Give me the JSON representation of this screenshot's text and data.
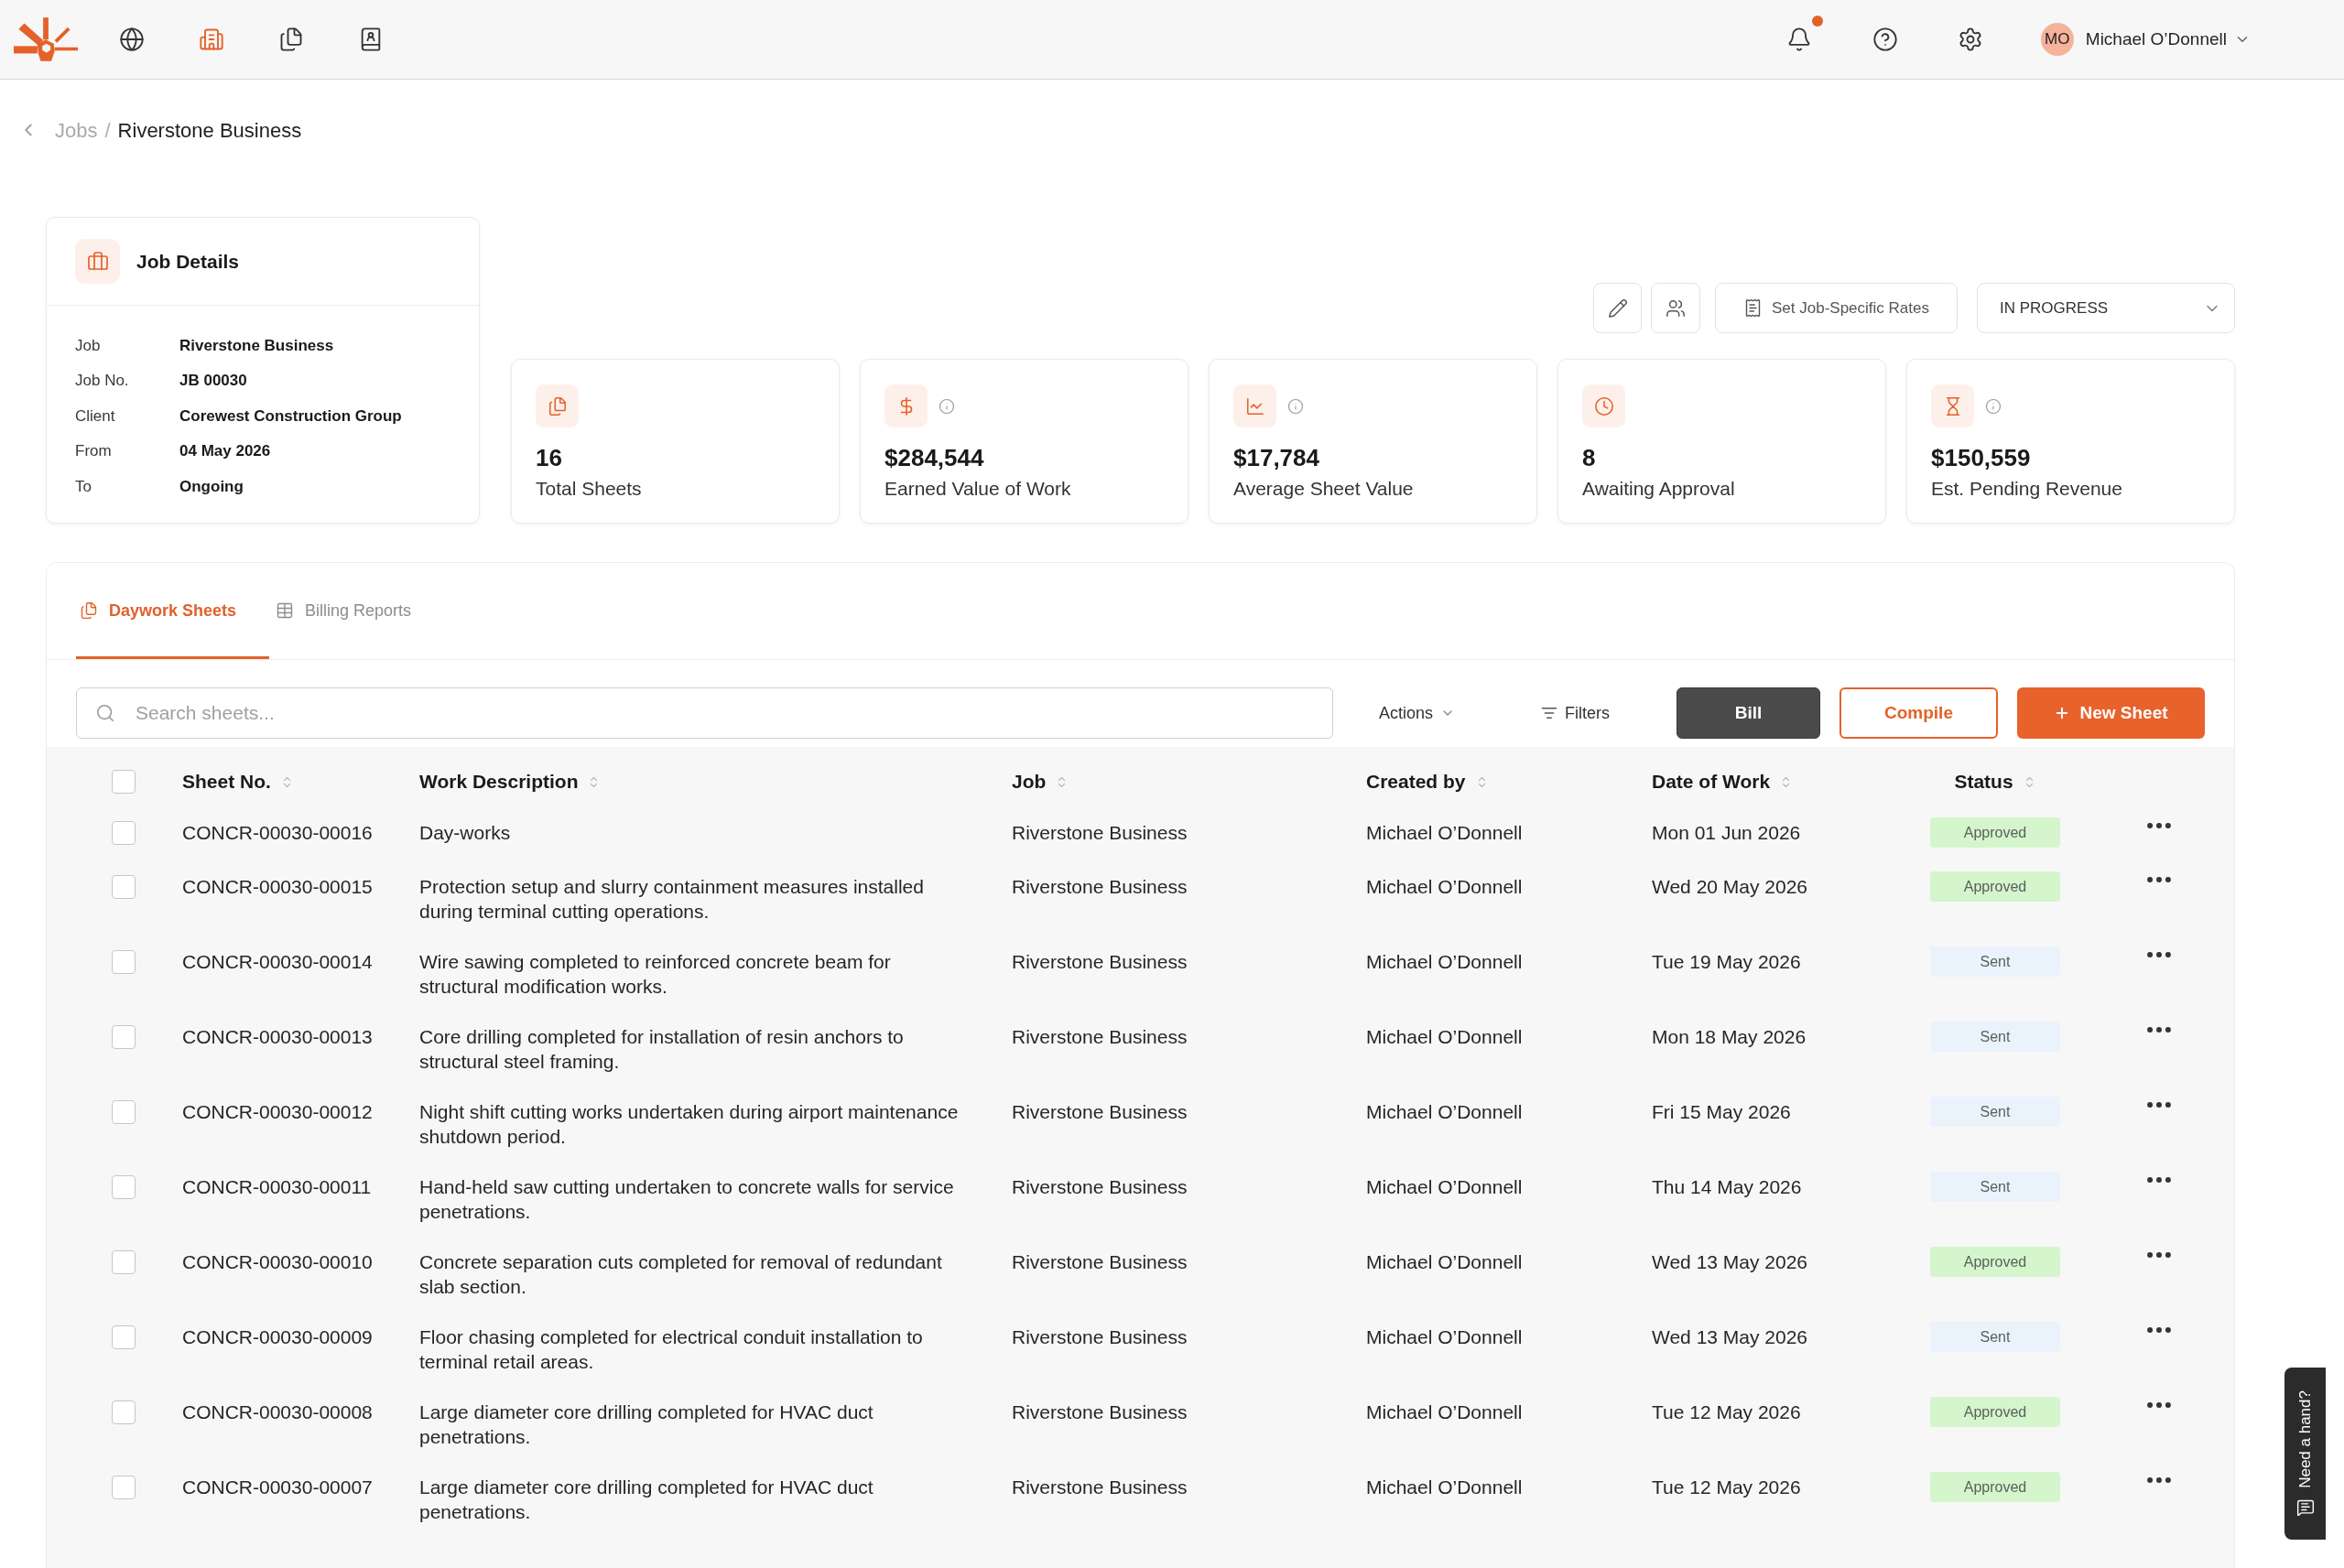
{
  "header": {
    "nav": [
      {
        "selected": false
      },
      {
        "selected": true
      },
      {
        "selected": false
      },
      {
        "selected": false
      }
    ],
    "notifications": {
      "unread": true
    },
    "user": {
      "initials": "MO",
      "name": "Michael O’Donnell"
    }
  },
  "breadcrumb": {
    "items": [
      "Jobs",
      "Riverstone Business"
    ],
    "separator": "/"
  },
  "job_details": {
    "title": "Job Details",
    "fields": [
      {
        "label": "Job",
        "value": "Riverstone Business"
      },
      {
        "label": "Job No.",
        "value": "JB 00030"
      },
      {
        "label": "Client",
        "value": "Corewest Construction Group"
      },
      {
        "label": "From",
        "value": "04 May 2026"
      },
      {
        "label": "To",
        "value": "Ongoing"
      }
    ]
  },
  "job_toolbar": {
    "rates_button": "Set Job-Specific Rates",
    "status": "IN PROGRESS"
  },
  "stats": [
    {
      "value": "16",
      "label": "Total Sheets",
      "info": false
    },
    {
      "value": "$284,544",
      "label": "Earned Value of Work",
      "info": true
    },
    {
      "value": "$17,784",
      "label": "Average Sheet Value",
      "info": true
    },
    {
      "value": "8",
      "label": "Awaiting Approval",
      "info": false
    },
    {
      "value": "$150,559",
      "label": "Est. Pending Revenue",
      "info": true
    }
  ],
  "tabs": [
    {
      "label": "Daywork Sheets",
      "selected": true
    },
    {
      "label": "Billing Reports",
      "selected": false
    }
  ],
  "sheet_toolbar": {
    "search": {
      "placeholder": "Search sheets..."
    },
    "actions": "Actions",
    "filters": "Filters",
    "bill": "Bill",
    "compile": "Compile",
    "new_sheet": "New Sheet"
  },
  "table": {
    "select_all": {
      "checked": false
    },
    "columns": [
      "Sheet No.",
      "Work Description",
      "Job",
      "Created by",
      "Date of Work",
      "Status"
    ],
    "rows": [
      {
        "checked": false,
        "sheet_no": "CONCR-00030-00016",
        "description": "Day-works",
        "job": "Riverstone Business",
        "created_by": "Michael O’Donnell",
        "date": "Mon 01 Jun 2026",
        "status": {
          "label": "Approved",
          "color": "#d5f5cc"
        }
      },
      {
        "checked": false,
        "sheet_no": "CONCR-00030-00015",
        "description": "Protection setup and slurry containment measures installed during terminal cutting operations.",
        "job": "Riverstone Business",
        "created_by": "Michael O’Donnell",
        "date": "Wed 20 May 2026",
        "status": {
          "label": "Approved",
          "color": "#d5f5cc"
        }
      },
      {
        "checked": false,
        "sheet_no": "CONCR-00030-00014",
        "description": "Wire sawing completed to reinforced concrete beam for structural modification works.",
        "job": "Riverstone Business",
        "created_by": "Michael O’Donnell",
        "date": "Tue 19 May 2026",
        "status": {
          "label": "Sent",
          "color": "#eaf3fc"
        }
      },
      {
        "checked": false,
        "sheet_no": "CONCR-00030-00013",
        "description": "Core drilling completed for installation of resin anchors to structural steel framing.",
        "job": "Riverstone Business",
        "created_by": "Michael O’Donnell",
        "date": "Mon 18 May 2026",
        "status": {
          "label": "Sent",
          "color": "#eaf3fc"
        }
      },
      {
        "checked": false,
        "sheet_no": "CONCR-00030-00012",
        "description": "Night shift cutting works undertaken during airport maintenance shutdown period.",
        "job": "Riverstone Business",
        "created_by": "Michael O’Donnell",
        "date": "Fri 15 May 2026",
        "status": {
          "label": "Sent",
          "color": "#eaf3fc"
        }
      },
      {
        "checked": false,
        "sheet_no": "CONCR-00030-00011",
        "description": "Hand-held saw cutting undertaken to concrete walls for service penetrations.",
        "job": "Riverstone Business",
        "created_by": "Michael O’Donnell",
        "date": "Thu 14 May 2026",
        "status": {
          "label": "Sent",
          "color": "#eaf3fc"
        }
      },
      {
        "checked": false,
        "sheet_no": "CONCR-00030-00010",
        "description": "Concrete separation cuts completed for removal of redundant slab section.",
        "job": "Riverstone Business",
        "created_by": "Michael O’Donnell",
        "date": "Wed 13 May 2026",
        "status": {
          "label": "Approved",
          "color": "#d5f5cc"
        }
      },
      {
        "checked": false,
        "sheet_no": "CONCR-00030-00009",
        "description": "Floor chasing completed for electrical conduit installation to terminal retail areas.",
        "job": "Riverstone Business",
        "created_by": "Michael O’Donnell",
        "date": "Wed 13 May 2026",
        "status": {
          "label": "Sent",
          "color": "#eaf3fc"
        }
      },
      {
        "checked": false,
        "sheet_no": "CONCR-00030-00008",
        "description": "Large diameter core drilling completed for HVAC duct penetrations.",
        "job": "Riverstone Business",
        "created_by": "Michael O’Donnell",
        "date": "Tue 12 May 2026",
        "status": {
          "label": "Approved",
          "color": "#d5f5cc"
        }
      },
      {
        "checked": false,
        "sheet_no": "CONCR-00030-00007",
        "description": "Large diameter core drilling completed for HVAC duct penetrations.",
        "job": "Riverstone Business",
        "created_by": "Michael O’Donnell",
        "date": "Tue 12 May 2026",
        "status": {
          "label": "Approved",
          "color": "#d5f5cc"
        }
      }
    ]
  },
  "help_tab": {
    "label": "Need a hand?"
  }
}
